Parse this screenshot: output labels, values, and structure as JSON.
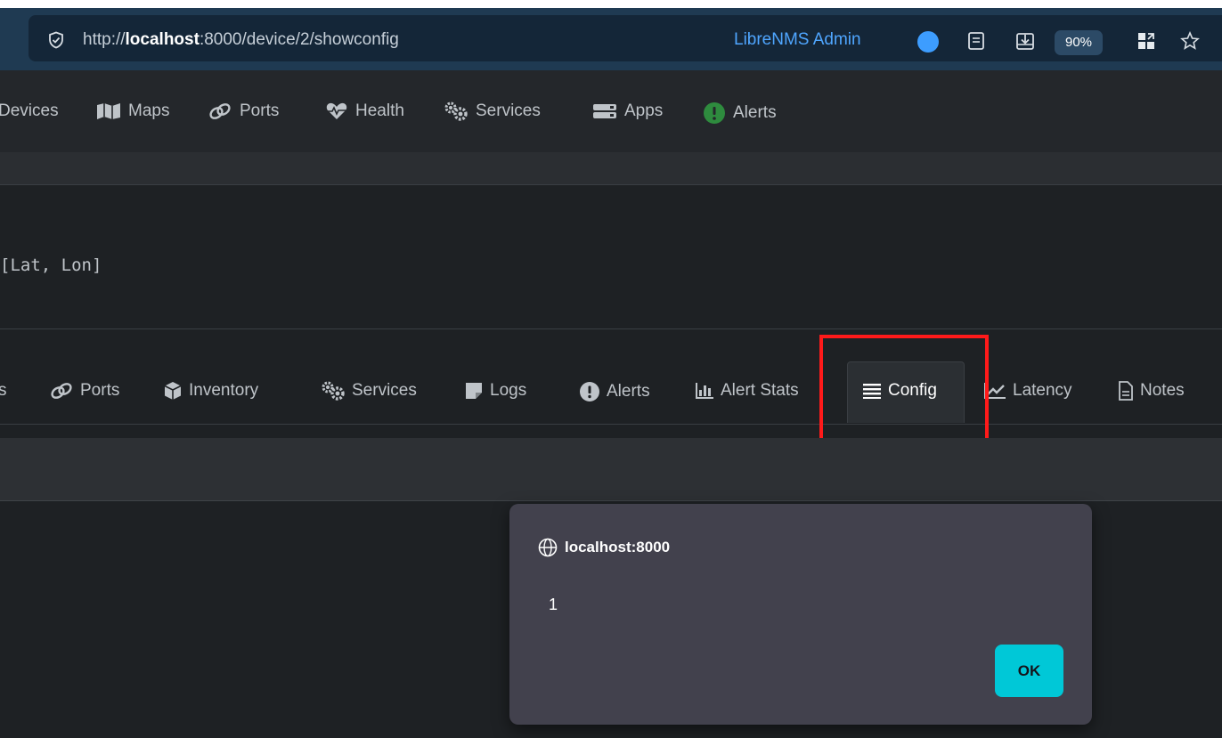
{
  "browser": {
    "url_prefix": "http://",
    "url_host": "localhost",
    "url_rest": ":8000/device/2/showconfig",
    "profile_label": "LibreNMS Admin",
    "zoom": "90%",
    "icons": [
      "shield-check-icon",
      "reader-mode-icon",
      "download-icon",
      "extensions-icon",
      "bookmark-star-icon"
    ]
  },
  "navbar": {
    "items": [
      {
        "label": "Devices",
        "icon": "server-icon"
      },
      {
        "label": "Maps",
        "icon": "map-icon"
      },
      {
        "label": "Ports",
        "icon": "link-icon"
      },
      {
        "label": "Health",
        "icon": "heartbeat-icon"
      },
      {
        "label": "Services",
        "icon": "cogs-icon"
      },
      {
        "label": "Apps",
        "icon": "tasks-icon"
      },
      {
        "label": "Alerts",
        "icon": "alert-circle-icon",
        "icon_color": "#2e8b3e"
      }
    ]
  },
  "device_header": {
    "location_hint": "[Lat, Lon]"
  },
  "device_tabs": {
    "items": [
      {
        "label": "s",
        "icon": ""
      },
      {
        "label": "Ports",
        "icon": "link-icon"
      },
      {
        "label": "Inventory",
        "icon": "cube-icon"
      },
      {
        "label": "Services",
        "icon": "cogs-icon"
      },
      {
        "label": "Logs",
        "icon": "sticky-note-icon"
      },
      {
        "label": "Alerts",
        "icon": "exclamation-circle-icon"
      },
      {
        "label": "Alert Stats",
        "icon": "bar-chart-icon"
      },
      {
        "label": "Config",
        "icon": "align-justify-icon",
        "active": true
      },
      {
        "label": "Latency",
        "icon": "line-chart-icon"
      },
      {
        "label": "Notes",
        "icon": "file-text-icon"
      }
    ]
  },
  "dialog": {
    "origin": "localhost:8000",
    "message": "1",
    "ok_label": "OK",
    "ok_color": "#00c8d7"
  },
  "colors": {
    "highlight": "#ff1a1a",
    "accent_link": "#4fa6ff"
  }
}
